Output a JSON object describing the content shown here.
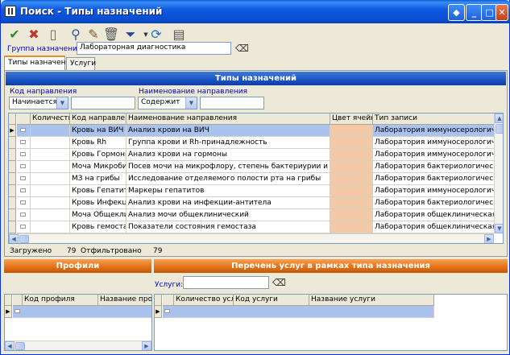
{
  "window": {
    "title": "Поиск - Типы назначений"
  },
  "toolbar": {
    "tools": [
      "check-icon",
      "delete-icon",
      "new-icon",
      "search-icon",
      "edit-icon",
      "trash-icon",
      "filter-icon",
      "refresh-icon",
      "report-icon"
    ]
  },
  "group": {
    "label": "Группа назначений:",
    "value": "Лабораторная диагностика"
  },
  "tabs": [
    "Типы назначений",
    "Услуги"
  ],
  "types": {
    "header": "Типы назначений",
    "filter1": {
      "label": "Код направления",
      "mode": "Начинается",
      "value": ""
    },
    "filter2": {
      "label": "Наименование направления",
      "mode": "Содержит",
      "value": ""
    },
    "columns": [
      "Количество",
      "Код направления",
      "Наименование направления",
      "Цвет ячейки",
      "Тип записи"
    ],
    "rows": [
      {
        "code": "Кровь на ВИЧ",
        "name": "Анализ крови на ВИЧ",
        "type": "Лаборатория иммуносерологическая"
      },
      {
        "code": "Кровь Rh",
        "name": "Группа крови и Rh-принадлежность",
        "type": "Лаборатория иммуносерологическая"
      },
      {
        "code": "Кровь Гормоны",
        "name": "Анализ крови на гормоны",
        "type": "Лаборатория иммуносерологическая"
      },
      {
        "code": "Моча Микробиоло",
        "name": "Посев мочи на микрофлору, степень бактериурии и чувств-ть к",
        "type": "Лаборатория бактериологическая"
      },
      {
        "code": "МЗ на грибы",
        "name": "Исследование отделяемого полости рта  на грибы",
        "type": "Лаборатория бактериологическая"
      },
      {
        "code": "Кровь Гепатит",
        "name": "Маркеры гепатитов",
        "type": "Лаборатория иммуносерологическая"
      },
      {
        "code": "Кровь Инфекции",
        "name": "Анализ крови на инфекции-антитела",
        "type": "Лаборатория бактериологическая"
      },
      {
        "code": "Моча Общеклинич",
        "name": "Анализ мочи общеклинический",
        "type": "Лаборатория общеклиническая"
      },
      {
        "code": "Кровь гемостаз",
        "name": "Показатели состояния гемостаза",
        "type": "Лаборатория общеклиническая"
      }
    ],
    "loaded_label": "Загружено",
    "loaded_value": "79",
    "filtered_label": "Отфильтровано",
    "filtered_value": "79"
  },
  "profiles": {
    "header": "Профили",
    "columns": [
      "Код профиля",
      "Название профи"
    ]
  },
  "services": {
    "header": "Перечень услуг в рамках типа назначения",
    "label": "Услуги:",
    "value": "",
    "columns": [
      "Количество услуг",
      "Код услуги",
      "Название услуги"
    ]
  },
  "colors": {
    "selected_row": "#aac2ee",
    "color_cell": "#f4c9a8",
    "blue_header": "#1b52c2",
    "orange_header": "#e36f14"
  }
}
